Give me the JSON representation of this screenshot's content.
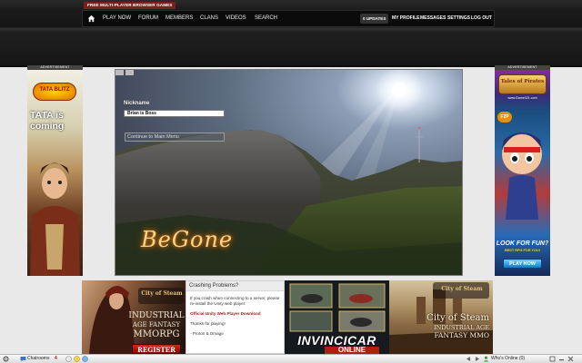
{
  "header": {
    "tagline": "FREE MULTI-PLAYER BROWSER GAMES",
    "nav": {
      "play_now": "PLAY NOW",
      "forum": "FORUM",
      "members": "MEMBERS",
      "clans": "CLANS",
      "videos": "VIDEOS",
      "search": "SEARCH"
    },
    "updates_badge": "0 UPDATES",
    "user_nav": {
      "my_profile": "MY PROFILE",
      "messages": "MESSAGES",
      "settings": "SETTINGS",
      "log_out": "LOG OUT"
    }
  },
  "ads": {
    "left_label": "ADVERTISEMENT",
    "left_brand": "TATA BLITZ",
    "left_headline": "TATA is coming",
    "right_label": "ADVERTISEMENT",
    "right_brand": "Tales of Pirates",
    "right_url": "www.Game321.com",
    "right_badge": "F2P",
    "right_headline": "LOOK FOR FUN?",
    "right_sub": "BEST RPG FOR YOU!",
    "right_button": "PLAY NOW",
    "bottom_left_brand": "City of Steam",
    "bottom_left_line1": "INDUSTRIAL",
    "bottom_left_line2": "AGE FANTASY",
    "bottom_left_line3": "MMORPG",
    "bottom_left_button": "REGISTER",
    "middle_title": "INVINCICAR",
    "middle_sub": "ONLINE",
    "bottom_right_brand": "City of Steam",
    "bottom_right_line1": "City of Steam",
    "bottom_right_line2": "INDUSTRIAL AGE",
    "bottom_right_line3": "FANTASY MMO"
  },
  "game": {
    "nickname_label": "Nickname",
    "nickname_value": "Brian is Boss",
    "continue_button": "Continue to Main Menu",
    "logo_text": "BeGone"
  },
  "crash": {
    "title": "Crashing Problems?",
    "line1": "If you crash when connecting to a server, please re-install the Unity web player:",
    "link": "Official Unity Web Player Download",
    "thanks": "Thanks for playing!",
    "sign": "- Proton & Dmage"
  },
  "chatbar": {
    "chatrooms": "Chatrooms",
    "chatroom_count": "4",
    "online": "Who's Online (0)"
  },
  "colors": {
    "tagline_bg": "#7d1d1d",
    "link_red": "#a02020",
    "glow_orange": "#e07a10"
  }
}
